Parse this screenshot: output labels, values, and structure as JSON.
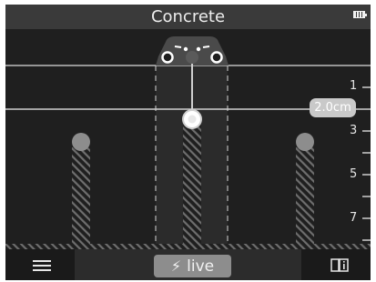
{
  "header": {
    "material": "Concrete",
    "battery_icon": "battery-full-icon"
  },
  "depth_scale": {
    "labels": [
      "1",
      "3",
      "5",
      "7"
    ]
  },
  "depth_readout": "2.0cm",
  "footer": {
    "menu_icon": "menu-icon",
    "live_label": "live",
    "live_icon": "lightning-icon",
    "manual_icon": "book-info-icon"
  },
  "colors": {
    "background": "#1f1f1f",
    "header": "#3a3a3a",
    "object_marker": "#8d8d8d",
    "detected_marker": "#ffffff",
    "readout": "#c9c9c9"
  }
}
